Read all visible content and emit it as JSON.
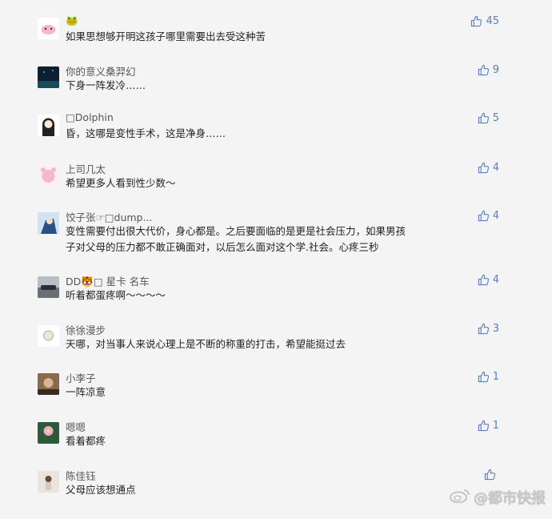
{
  "comments": [
    {
      "name": "🐸",
      "text": "如果思想够开明这孩子哪里需要出去受这种苦",
      "likes": "45",
      "avatar": "pink-sheep"
    },
    {
      "name": "你的意义桑羿幻",
      "text": "下身一阵发冷……",
      "likes": "9",
      "avatar": "night-sky"
    },
    {
      "name": "□Dolphin",
      "text": "昏，这哪是变性手术，这是净身……",
      "likes": "5",
      "avatar": "anime-girl"
    },
    {
      "name": "上司几太",
      "text": "希望更多人看到性少数～",
      "likes": "4",
      "avatar": "pink-bear"
    },
    {
      "name": "饺子张☞□dump...",
      "text": "变性需要付出很大代价，身心都是。之后要面临的是更是社会压力，如果男孩子对父母的压力都不敢正确面对，以后怎么面对这个学.社会。心疼三秒",
      "likes": "4",
      "avatar": "anime-blue"
    },
    {
      "name": "DD🐯□ 星卡 名车",
      "text": "听着都蛋疼啊～～～～",
      "likes": "4",
      "avatar": "car"
    },
    {
      "name": "徐徐漫步",
      "text": "天哪，对当事人来说心理上是不断的称重的打击，希望能挺过去",
      "likes": "3",
      "avatar": "cartoon"
    },
    {
      "name": "小李子",
      "text": "一阵凉意",
      "likes": "1",
      "avatar": "portrait"
    },
    {
      "name": "嗯嗯",
      "text": "看着都疼",
      "likes": "1",
      "avatar": "flower"
    },
    {
      "name": "陈佳钰",
      "text": "父母应该想通点",
      "likes": "",
      "avatar": "girl"
    }
  ],
  "watermark": {
    "text": "@都市快报"
  },
  "icons": {
    "like": "thumbs-up-icon",
    "weibo": "weibo-logo-icon"
  },
  "colors": {
    "like": "#5a7fbd",
    "name": "#555555",
    "text": "#222222",
    "background": "#f4f4f4"
  }
}
